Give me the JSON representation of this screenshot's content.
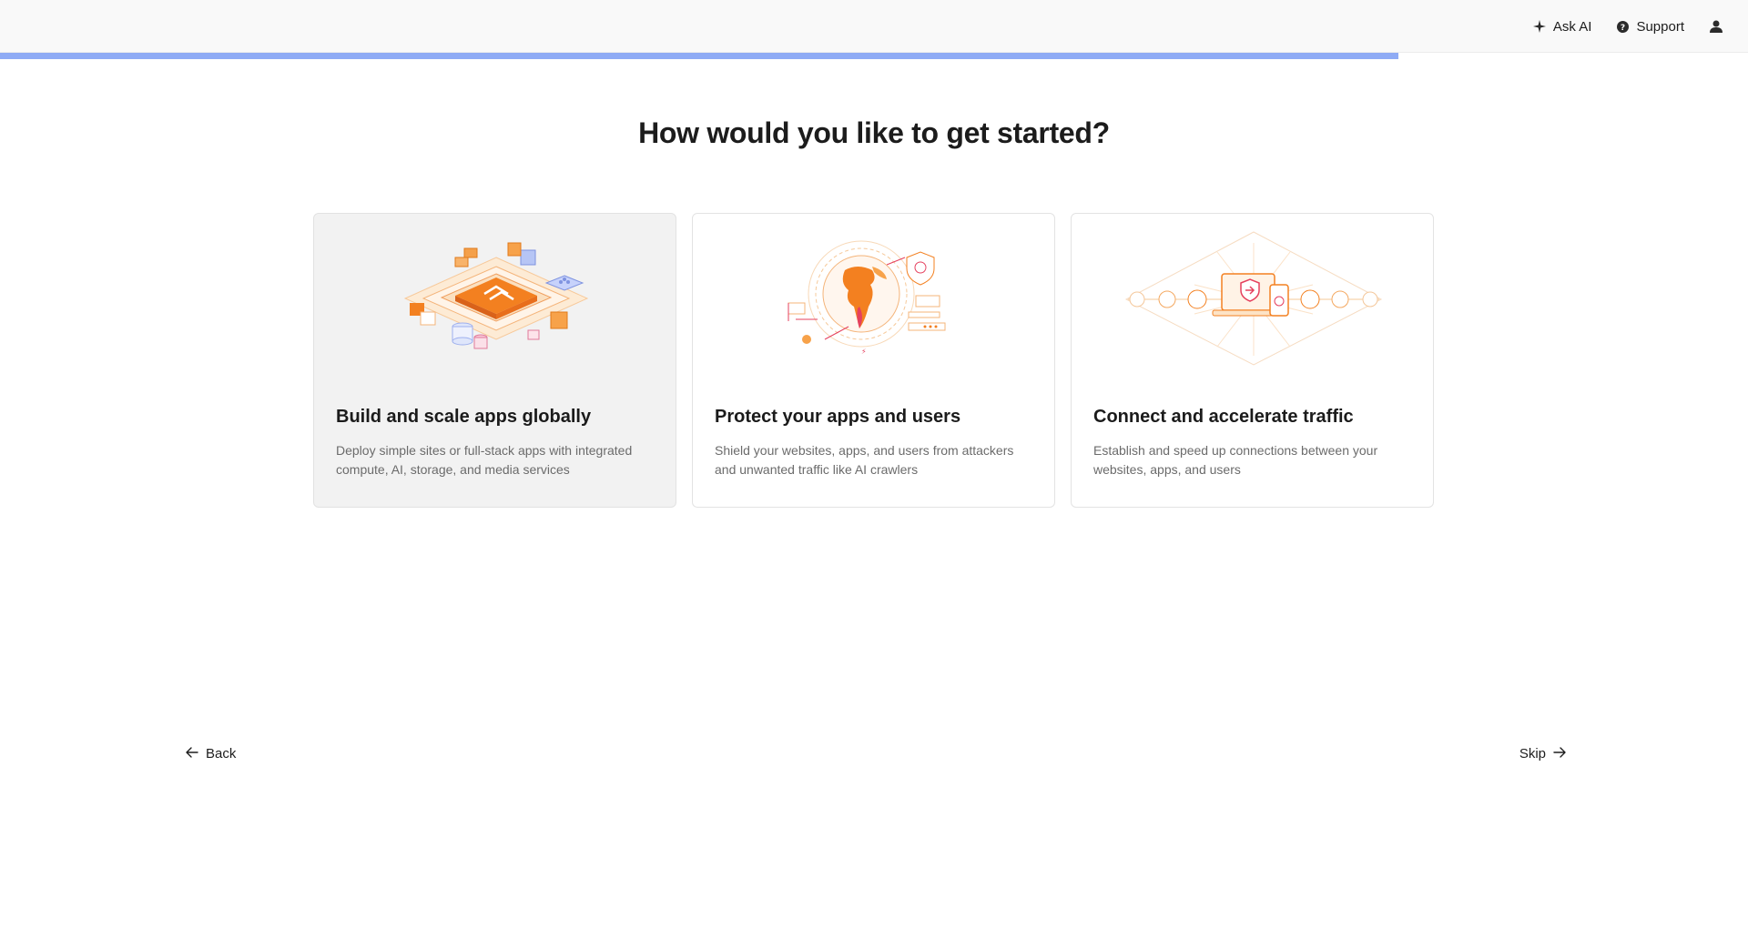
{
  "header": {
    "ask_ai": {
      "label": "Ask AI",
      "icon": "sparkle-icon"
    },
    "support": {
      "label": "Support",
      "icon": "help-circle-icon"
    },
    "account": {
      "icon": "user-icon"
    }
  },
  "progress": {
    "fraction": 0.8
  },
  "page": {
    "heading": "How would you like to get started?"
  },
  "cards": [
    {
      "title": "Build and scale apps globally",
      "description": "Deploy simple sites or full-stack apps with integrated compute, AI, storage, and media services",
      "illustration": "isometric-platform-illustration",
      "selected": true
    },
    {
      "title": "Protect your apps and users",
      "description": "Shield your websites, apps, and users from attackers and unwanted traffic like AI crawlers",
      "illustration": "globe-shield-illustration",
      "selected": false
    },
    {
      "title": "Connect and accelerate traffic",
      "description": "Establish and speed up connections between your websites, apps, and users",
      "illustration": "laptop-network-illustration",
      "selected": false
    }
  ],
  "footer": {
    "back_label": "Back",
    "skip_label": "Skip"
  },
  "colors": {
    "accent": "#f38020",
    "progress": "#8fabf5"
  }
}
